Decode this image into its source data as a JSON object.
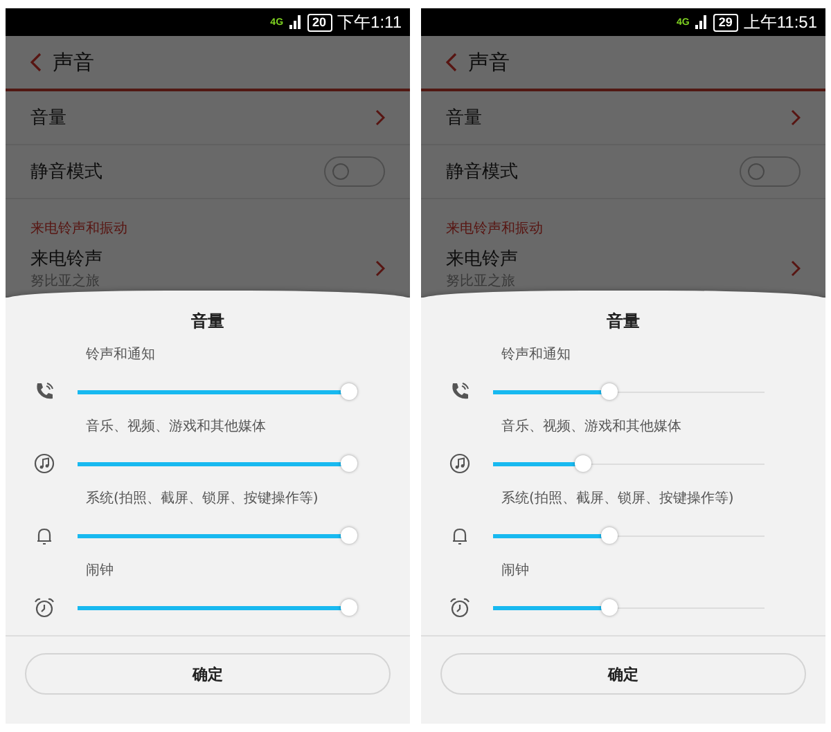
{
  "phones": [
    {
      "status_bar": {
        "network": "4G",
        "battery": "20",
        "time": "下午1:11"
      },
      "title": "声音",
      "settings": [
        {
          "kind": "nav",
          "label": "音量"
        },
        {
          "kind": "toggle",
          "label": "静音模式",
          "on": false
        },
        {
          "kind": "section",
          "label": "来电铃声和振动"
        },
        {
          "kind": "nav",
          "label": "来电铃声",
          "subtitle": "努比亚之旅"
        }
      ],
      "dialog": {
        "title": "音量",
        "sliders": [
          {
            "label": "铃声和通知",
            "level": 1
          },
          {
            "label": "音乐、视频、游戏和其他媒体",
            "level": 1
          },
          {
            "label": "系统(拍照、截屏、锁屏、按键操作等)",
            "level": 1
          },
          {
            "label": "闹钟",
            "level": 1
          }
        ],
        "button": "确定"
      }
    },
    {
      "status_bar": {
        "network": "4G",
        "battery": "29",
        "time": "上午11:51"
      },
      "title": "声音",
      "settings": [
        {
          "kind": "nav",
          "label": "音量"
        },
        {
          "kind": "toggle",
          "label": "静音模式",
          "on": false
        },
        {
          "kind": "section",
          "label": "来电铃声和振动"
        },
        {
          "kind": "nav",
          "label": "来电铃声",
          "subtitle": "努比亚之旅"
        }
      ],
      "dialog": {
        "title": "音量",
        "sliders": [
          {
            "label": "铃声和通知",
            "level": 0.43
          },
          {
            "label": "音乐、视频、游戏和其他媒体",
            "level": 0.33
          },
          {
            "label": "系统(拍照、截屏、锁屏、按键操作等)",
            "level": 0.43
          },
          {
            "label": "闹钟",
            "level": 0.43
          }
        ],
        "button": "确定"
      }
    }
  ]
}
